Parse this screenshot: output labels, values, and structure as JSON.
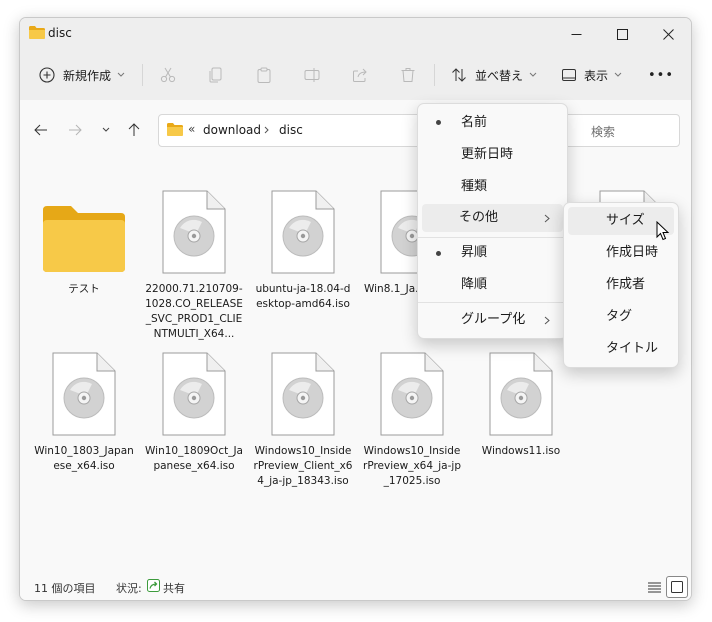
{
  "window": {
    "title": "disc"
  },
  "toolbar": {
    "new_label": "新規作成",
    "sort_label": "並べ替え",
    "view_label": "表示",
    "more_label": "•••"
  },
  "address": {
    "prefix": "«",
    "crumbs": [
      "download",
      "disc"
    ]
  },
  "search": {
    "placeholder": "検索"
  },
  "files": [
    {
      "name": "テスト",
      "type": "folder"
    },
    {
      "name": "22000.71.210709-1028.CO_RELEASE_SVC_PROD1_CLIENTMULTI_X64...",
      "type": "disc"
    },
    {
      "name": "ubuntu-ja-18.04-desktop-amd64.iso",
      "type": "disc"
    },
    {
      "name": "Win8.1_Ja..._x64...",
      "type": "disc"
    },
    {
      "name": "",
      "type": "disc"
    },
    {
      "name": "",
      "type": "disc"
    },
    {
      "name": "Win10_1803_Japanese_x64.iso",
      "type": "disc"
    },
    {
      "name": "Win10_1809Oct_Japanese_x64.iso",
      "type": "disc"
    },
    {
      "name": "Windows10_InsiderPreview_Client_x64_ja-jp_18343.iso",
      "type": "disc"
    },
    {
      "name": "Windows10_InsiderPreview_x64_ja-jp_17025.iso",
      "type": "disc"
    },
    {
      "name": "Windows11.iso",
      "type": "disc"
    }
  ],
  "status": {
    "count": "11 個の項目",
    "state_label": "状況:",
    "state_value": "共有"
  },
  "sort_menu": {
    "items": [
      "名前",
      "更新日時",
      "種類",
      "その他",
      "昇順",
      "降順",
      "グループ化"
    ],
    "bullets": [
      true,
      false,
      false,
      false,
      true,
      false,
      false
    ]
  },
  "submenu": {
    "items": [
      "サイズ",
      "作成日時",
      "作成者",
      "タグ",
      "タイトル"
    ]
  },
  "colors": {
    "accent": "#0067c0",
    "folder": "#f4c53a",
    "menu_hover": "#ececec"
  }
}
